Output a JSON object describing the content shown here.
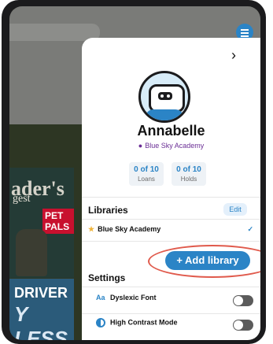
{
  "magazines": {
    "top": {
      "title": "ader's",
      "subtitle": "gest",
      "badge": "PET PALS"
    },
    "bottom": {
      "title": "DRIVER",
      "subtitle": "Y LESS"
    }
  },
  "panel": {
    "close_icon": "chevron-right-icon",
    "user_name": "Annabelle",
    "school": "Blue Sky Academy",
    "stats": [
      {
        "value": "0 of 10",
        "label": "Loans"
      },
      {
        "value": "0 of 10",
        "label": "Holds"
      }
    ],
    "libraries_heading": "Libraries",
    "edit_label": "Edit",
    "library_name": "Blue Sky Academy",
    "add_library_label": "+ Add library",
    "settings_heading": "Settings",
    "settings": [
      {
        "icon": "Aa",
        "label": "Dyslexic Font",
        "enabled": false
      },
      {
        "icon": "high-contrast-icon",
        "label": "High Contrast Mode",
        "enabled": false
      }
    ]
  },
  "colors": {
    "accent": "#2b84c6",
    "school": "#6a2e95",
    "highlight": "#e05a4c"
  }
}
